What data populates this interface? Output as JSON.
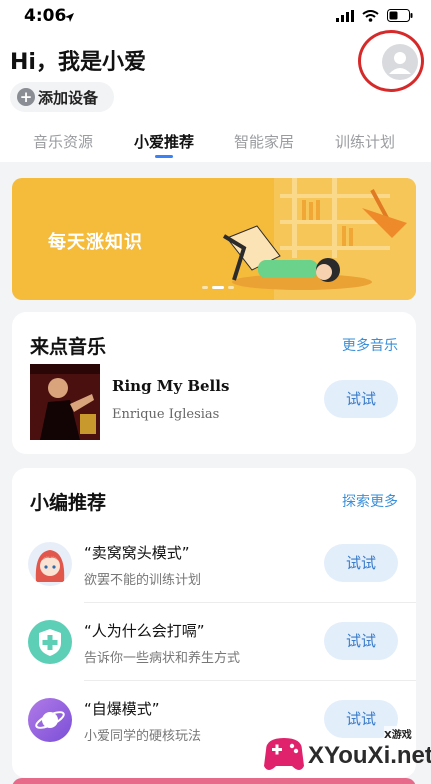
{
  "status_bar": {
    "time": "4:06",
    "location_icon": "location-arrow-icon",
    "signal_icon": "signal-icon",
    "wifi_icon": "wifi-icon",
    "battery_icon": "battery-icon"
  },
  "header": {
    "greeting": "Hi，我是小爱",
    "add_device_label": "添加设备",
    "avatar_icon": "user-avatar-icon"
  },
  "tabs": [
    {
      "label": "音乐资源"
    },
    {
      "label": "小爱推荐",
      "active": true
    },
    {
      "label": "智能家居"
    },
    {
      "label": "训练计划"
    }
  ],
  "banner": {
    "text": "每天涨知识"
  },
  "music_card": {
    "title": "来点音乐",
    "more_link": "更多音乐",
    "song_title": "Ring My Bells",
    "song_artist": "Enrique Iglesias",
    "try_label": "试试"
  },
  "recommend_card": {
    "title": "小编推荐",
    "more_link": "探索更多",
    "items": [
      {
        "title": "“卖窝窝头模式”",
        "subtitle": "欲罢不能的训练计划",
        "try_label": "试试",
        "icon": "anime-avatar-icon"
      },
      {
        "title": "“人为什么会打嗝”",
        "subtitle": "告诉你一些病状和养生方式",
        "try_label": "试试",
        "icon": "health-shield-icon"
      },
      {
        "title": "“自爆模式”",
        "subtitle": "小爱同学的硬核玩法",
        "try_label": "试试",
        "icon": "planet-icon"
      }
    ]
  },
  "watermark": {
    "tag": "X游戏",
    "text": "XYouXi.net",
    "icon": "gamepad-logo-icon"
  },
  "colors": {
    "accent": "#3b82f6",
    "link": "#3a8fd9",
    "banner": "#f5bb3b",
    "try_button_bg": "#e3eefb",
    "highlight_ring": "#d62a2a"
  }
}
